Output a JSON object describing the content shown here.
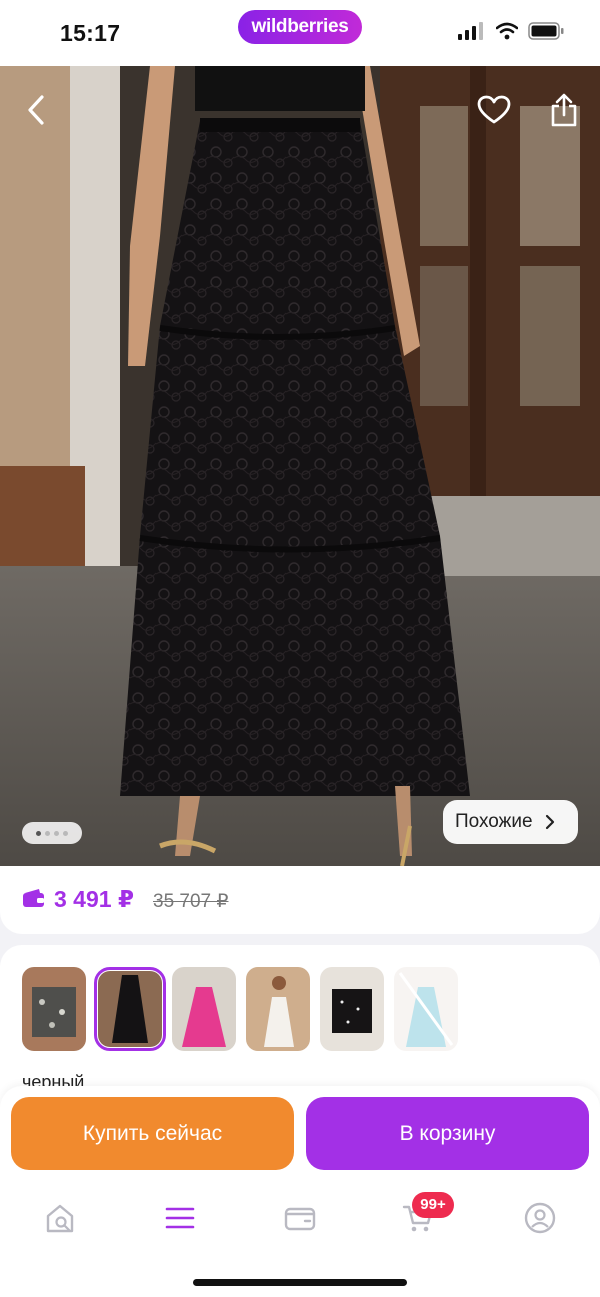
{
  "status_bar": {
    "time": "15:17",
    "brand": "wildberries"
  },
  "hero": {
    "similar_label": "Похожие",
    "page_count": 4,
    "active_page": 1
  },
  "price": {
    "current": "3 491 ₽",
    "old": "35 707 ₽",
    "accent_color": "#a330e6"
  },
  "variants": {
    "items": [
      {
        "name": "thumb-1",
        "state": "normal"
      },
      {
        "name": "thumb-2",
        "state": "selected"
      },
      {
        "name": "thumb-3",
        "state": "normal"
      },
      {
        "name": "thumb-4",
        "state": "normal"
      },
      {
        "name": "thumb-5",
        "state": "normal"
      },
      {
        "name": "thumb-6",
        "state": "unavailable"
      }
    ],
    "color_label": "черный"
  },
  "actions": {
    "buy_now": "Купить сейчас",
    "to_cart": "В корзину",
    "buy_color": "#f18a2e",
    "cart_color": "#a330e6"
  },
  "tabbar": {
    "icons": [
      "home-search-icon",
      "catalog-menu-icon",
      "wallet-icon",
      "cart-icon",
      "profile-icon"
    ],
    "cart_badge": "99+"
  }
}
